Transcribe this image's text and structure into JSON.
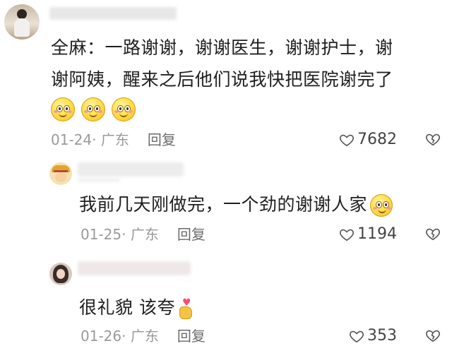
{
  "comments": [
    {
      "lines": [
        "全麻：一路谢谢，谢谢医生，谢谢护士，谢",
        "谢阿姨，醒来之后他们说我快把医院谢完了"
      ],
      "emoji_count": 3,
      "emoji_name": "smiling-face-emoji",
      "date": "01-24",
      "location": "· 广东",
      "reply_label": "回复",
      "likes": "7682"
    }
  ],
  "replies": [
    {
      "text": "我前几天刚做完，一个劲的谢谢人家",
      "emoji_name": "smiling-face-emoji",
      "date": "01-25",
      "location": "· 广东",
      "reply_label": "回复",
      "likes": "1194"
    },
    {
      "text": "很礼貌 该夸",
      "emoji_name": "finger-heart-emoji",
      "date": "01-26",
      "location": "· 广东",
      "reply_label": "回复",
      "likes": "353"
    }
  ],
  "icons": {
    "like": "heart-outline-icon",
    "dislike": "broken-heart-icon"
  },
  "colors": {
    "text": "#1f1f1f",
    "meta": "#9a9a9a",
    "reply": "#6b6b6b",
    "likes": "#444444"
  }
}
